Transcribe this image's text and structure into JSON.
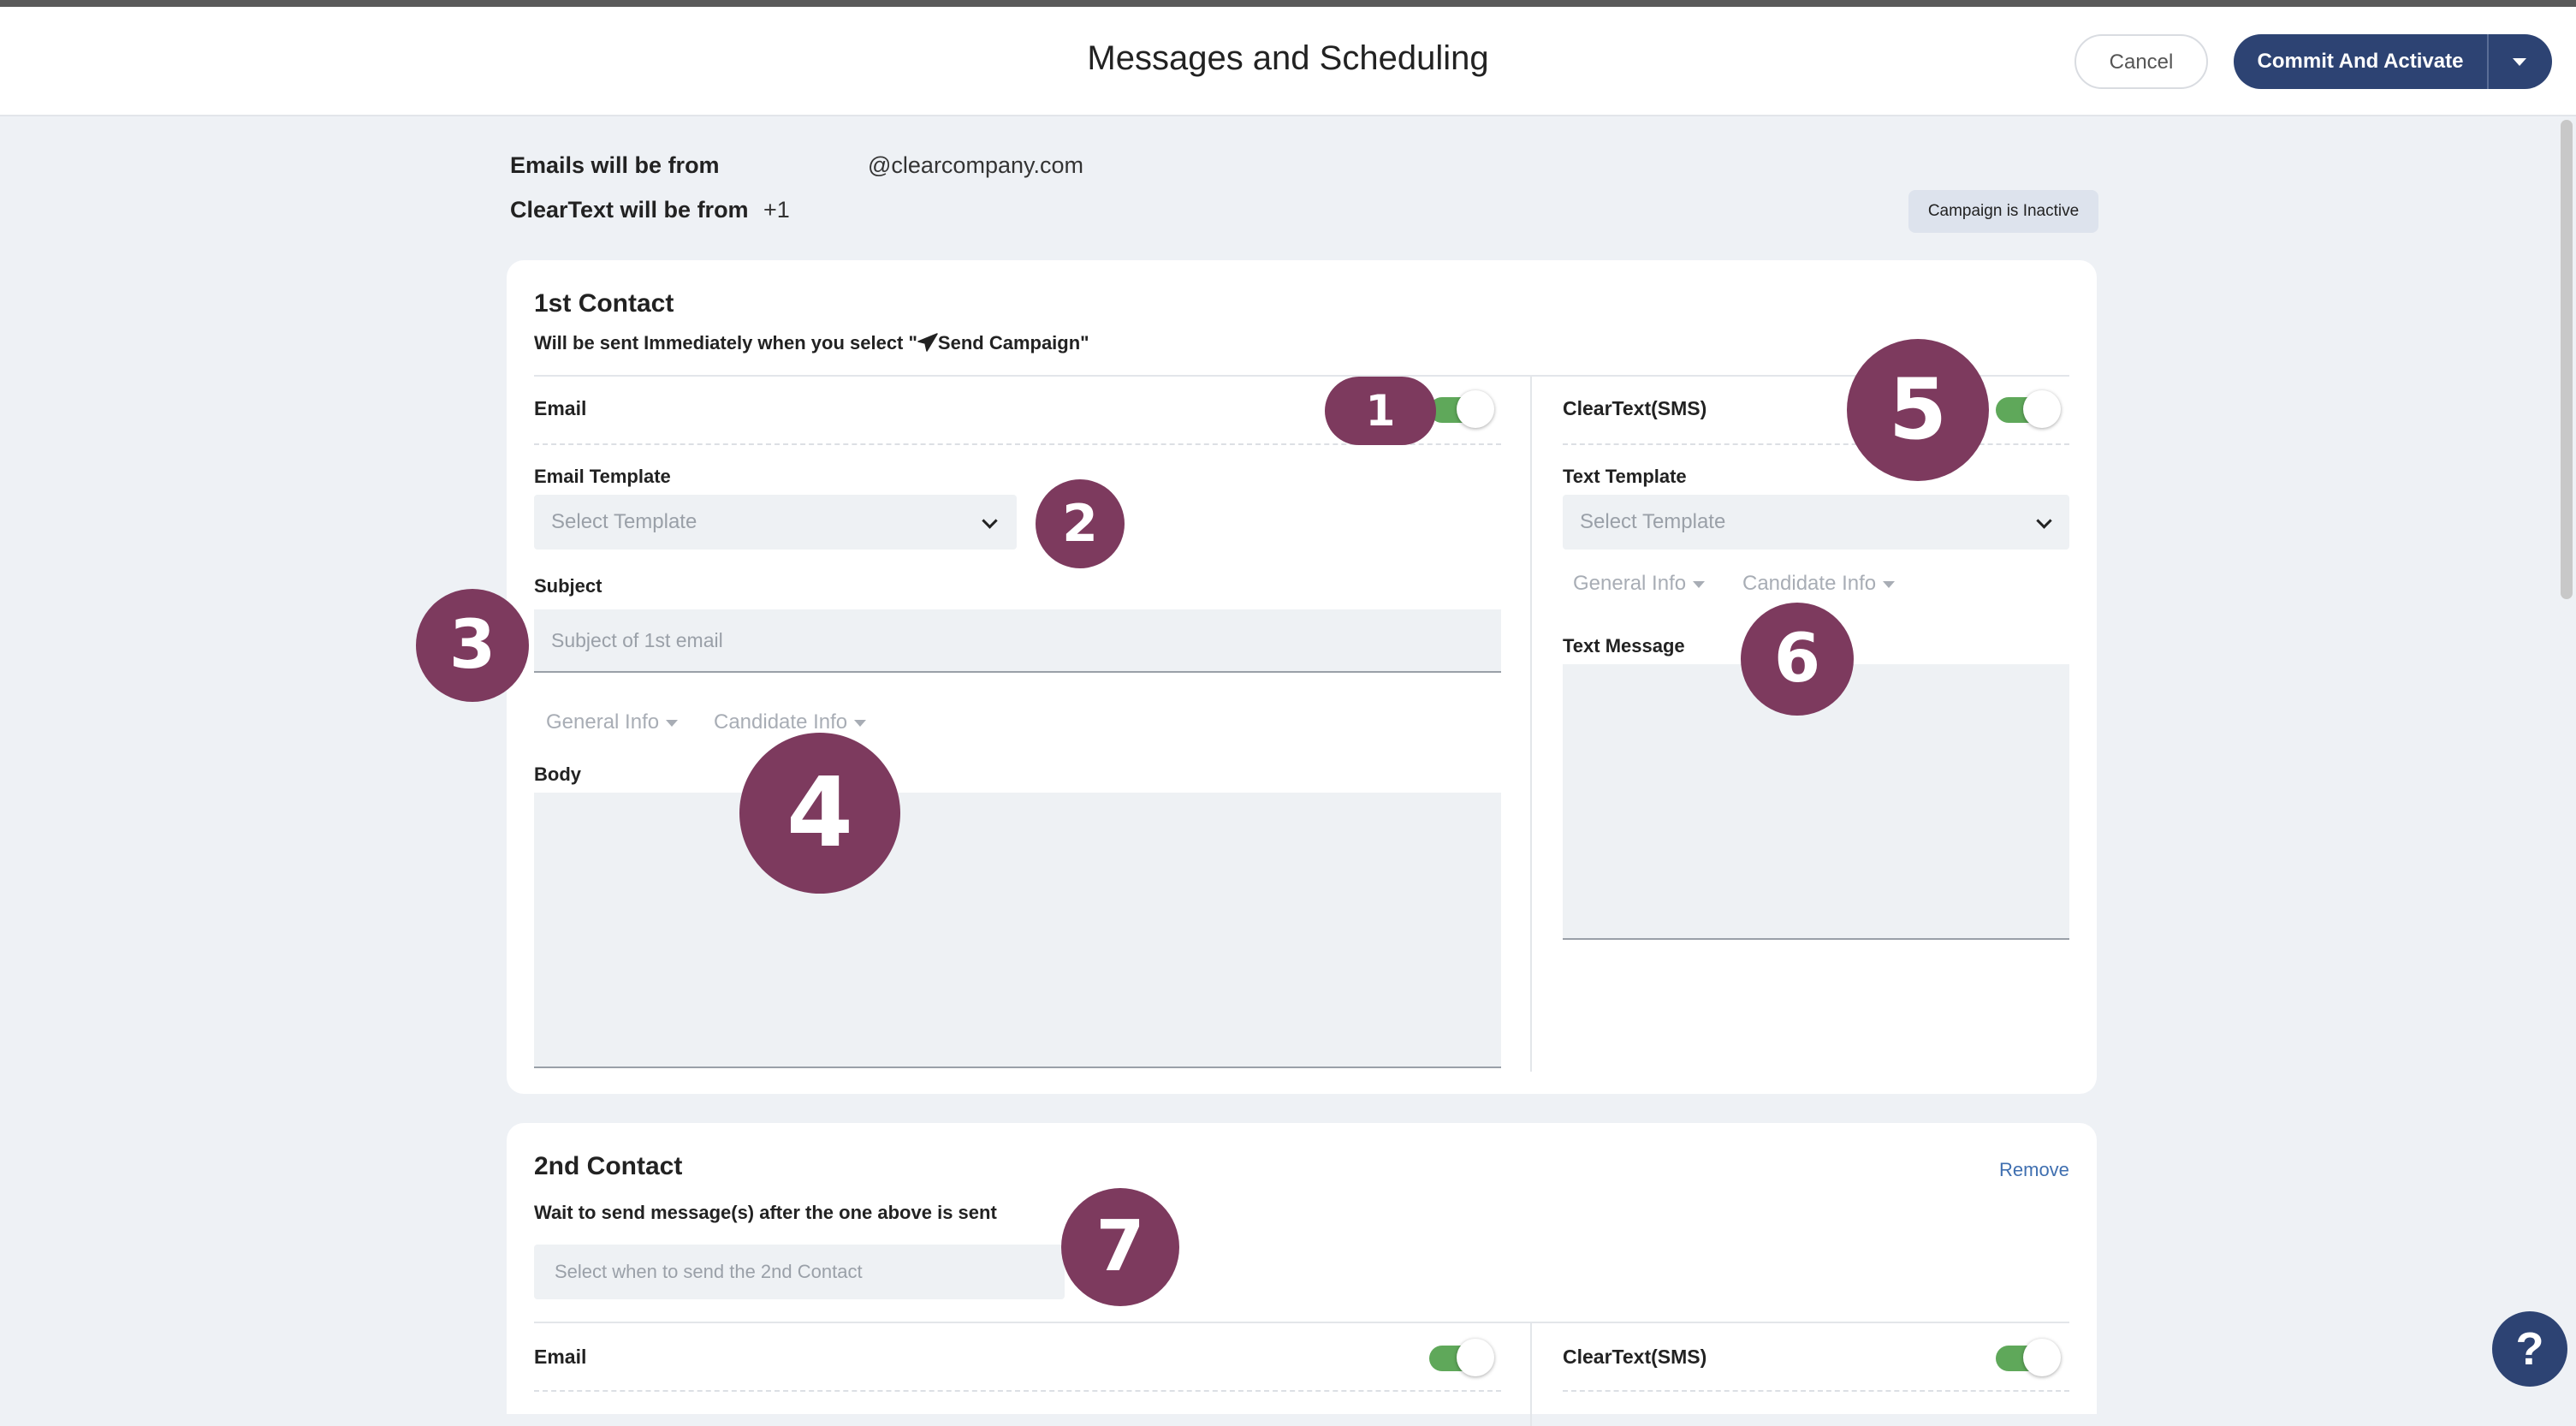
{
  "header": {
    "title": "Messages and Scheduling",
    "cancel_label": "Cancel",
    "commit_label": "Commit And Activate",
    "caret_icon": "caret-down-icon"
  },
  "sender": {
    "email_label": "Emails will be from",
    "email_value": "@clearcompany.com",
    "text_label": "ClearText will be from",
    "text_value": "+1",
    "status_badge": "Campaign is Inactive"
  },
  "contact1": {
    "title": "1st Contact",
    "subtitle": "Will be sent Immediately when you select \"",
    "subtitle_action": "Send Campaign",
    "subtitle_end": "\"",
    "send_icon": "paper-plane-icon",
    "email": {
      "label": "Email",
      "enabled": true,
      "template_label": "Email Template",
      "template_placeholder": "Select Template",
      "subject_label": "Subject",
      "subject_placeholder": "Subject of 1st email",
      "menus": [
        "General Info",
        "Candidate Info"
      ],
      "body_label": "Body"
    },
    "sms": {
      "label": "ClearText(SMS)",
      "enabled": true,
      "template_label": "Text Template",
      "template_placeholder": "Select Template",
      "menus": [
        "General Info",
        "Candidate Info"
      ],
      "message_label": "Text Message"
    }
  },
  "contact2": {
    "title": "2nd Contact",
    "remove_label": "Remove",
    "subtitle": "Wait to send message(s) after the one above is sent",
    "when_placeholder": "Select when to send the 2nd Contact",
    "email_label": "Email",
    "email_enabled": true,
    "sms_label": "ClearText(SMS)",
    "sms_enabled": true
  },
  "markers": [
    "1",
    "2",
    "3",
    "4",
    "5",
    "6",
    "7"
  ],
  "help": {
    "label": "?"
  },
  "colors": {
    "primary": "#2d4373",
    "toggle_on": "#5fa85a",
    "marker": "#7d3a5e",
    "link": "#3f6fb0"
  }
}
